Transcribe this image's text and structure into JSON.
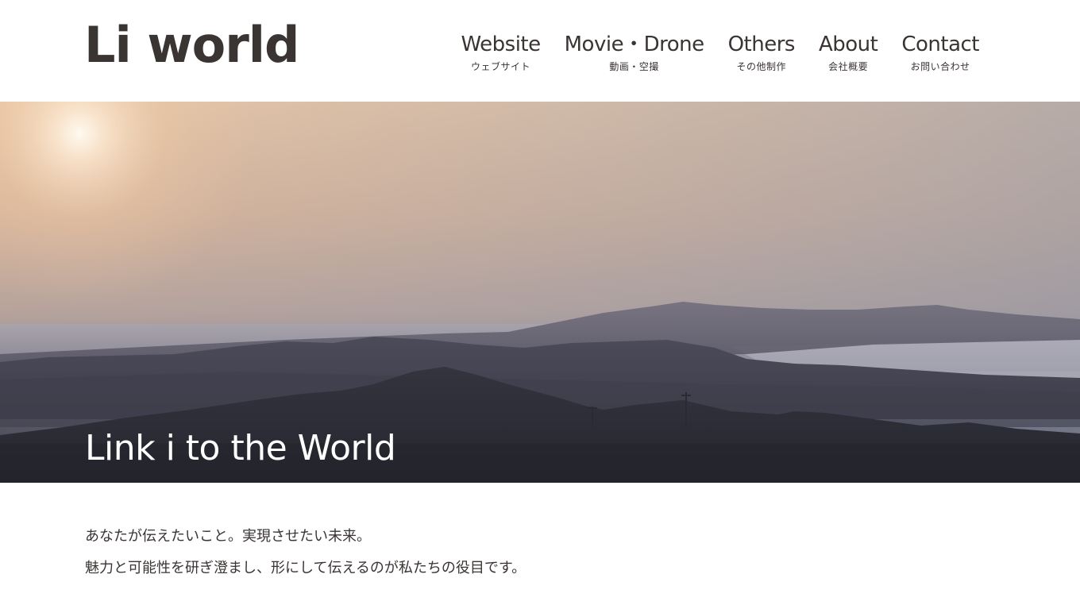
{
  "header": {
    "logo_text": "Li world",
    "nav": [
      {
        "en": "Website",
        "ja": "ウェブサイト"
      },
      {
        "en": "Movie・Drone",
        "ja": "動画・空撮"
      },
      {
        "en": "Others",
        "ja": "その他制作"
      },
      {
        "en": "About",
        "ja": "会社概要"
      },
      {
        "en": "Contact",
        "ja": "お問い合わせ"
      }
    ]
  },
  "hero": {
    "title": "Link i to the World"
  },
  "intro": {
    "lines": [
      "あなたが伝えたいこと。実現させたい未来。",
      "魅力と可能性を研ぎ澄まし、形にして伝えるのが私たちの役目です。"
    ]
  },
  "colors": {
    "text": "#3a3433",
    "background": "#ffffff",
    "hero_text": "#ffffff"
  }
}
